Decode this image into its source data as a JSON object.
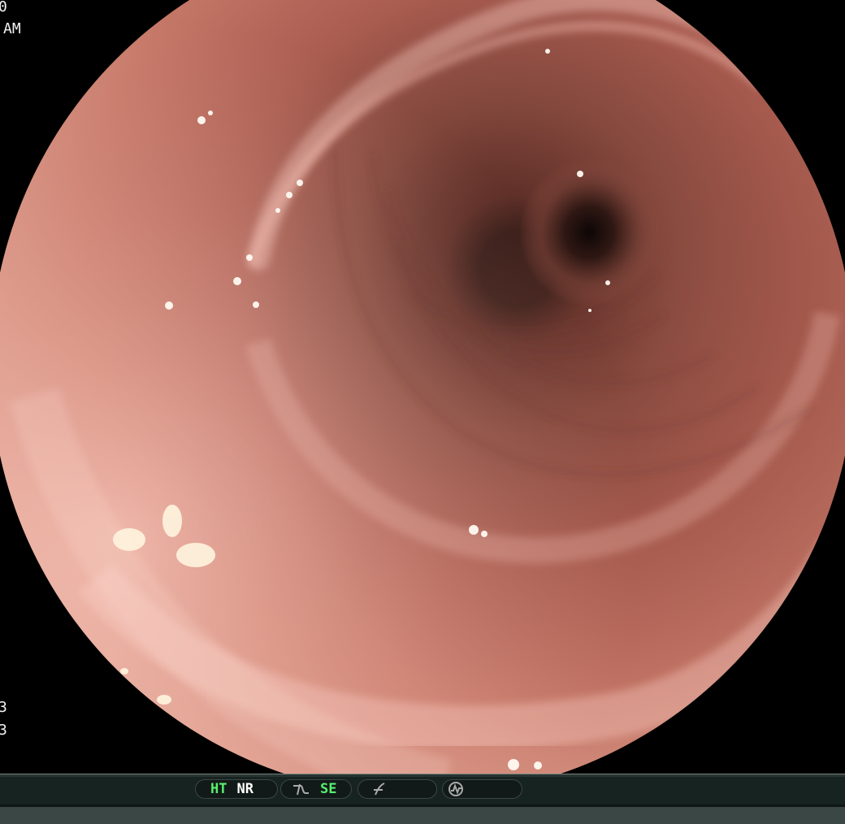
{
  "overlay": {
    "top_left_line_1": "0",
    "top_left_line_2": "AM",
    "bottom_left_line_1": "3",
    "bottom_left_line_2": "3"
  },
  "status_bar": {
    "mode_1": "HT",
    "mode_2": "NR",
    "mode_3": "SE",
    "icons": [
      "signal-curve-icon",
      "function-icon",
      "waveform-icon"
    ],
    "colors": {
      "active": "#58f06d",
      "text": "#ffffff",
      "panel": "#121a19"
    }
  }
}
